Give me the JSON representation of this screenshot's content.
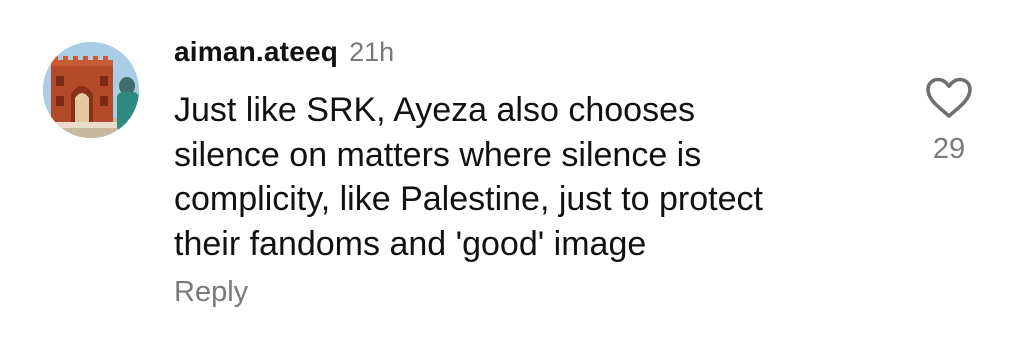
{
  "comment": {
    "username": "aiman.ateeq",
    "timestamp": "21h",
    "text": "Just like SRK, Ayeza also chooses\nsilence on matters where silence is\ncomplicity, like Palestine, just to protect\ntheir fandoms and 'good' image",
    "reply_label": "Reply",
    "like_count": "29",
    "avatar_icon": "profile-photo-red-fort-icon",
    "like_icon": "heart-outline-icon"
  },
  "colors": {
    "primary_text": "#111111",
    "secondary_text": "#7a7a7a",
    "background": "#ffffff"
  }
}
